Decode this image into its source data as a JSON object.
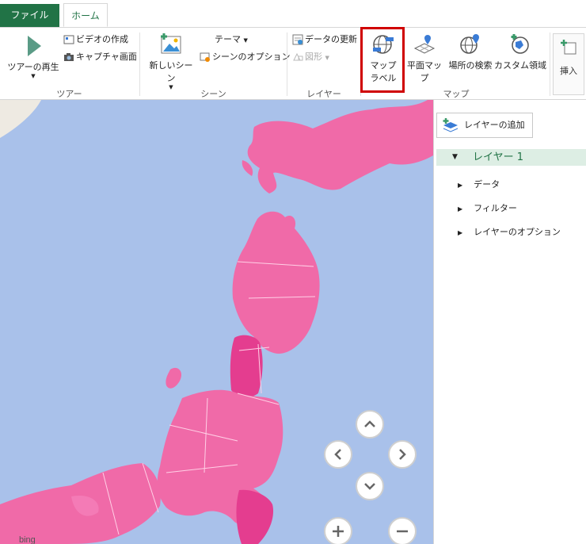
{
  "tabs": {
    "file": "ファイル",
    "home": "ホーム"
  },
  "ribbon": {
    "tour": {
      "play": "ツアーの再生",
      "create_video": "ビデオの作成",
      "capture": "キャプチャ画面",
      "group": "ツアー"
    },
    "scene": {
      "new_scene": "新しいシーン",
      "theme": "テーマ",
      "scene_options": "シーンのオプション",
      "group": "シーン"
    },
    "layer": {
      "refresh": "データの更新",
      "shapes": "図形",
      "group": "レイヤー"
    },
    "map": {
      "map_labels_line1": "マップ",
      "map_labels_line2": "ラベル",
      "flat_map": "平面マップ",
      "find_location": "場所の検索",
      "custom_regions": "カスタム領域",
      "group": "マップ"
    },
    "insert": {
      "label": "挿入"
    }
  },
  "panel": {
    "add_layer": "レイヤーの追加",
    "layer_name": "レイヤー 1",
    "items": [
      "データ",
      "フィルター",
      "レイヤーのオプション"
    ]
  },
  "map": {
    "attribution": "bing"
  },
  "colors": {
    "brand": "#217346",
    "highlight": "#d00000",
    "sea": "#a9c1ea",
    "land": "#f06aa8",
    "land_dark": "#e43d8f",
    "layer_bg": "#ddeee4"
  }
}
